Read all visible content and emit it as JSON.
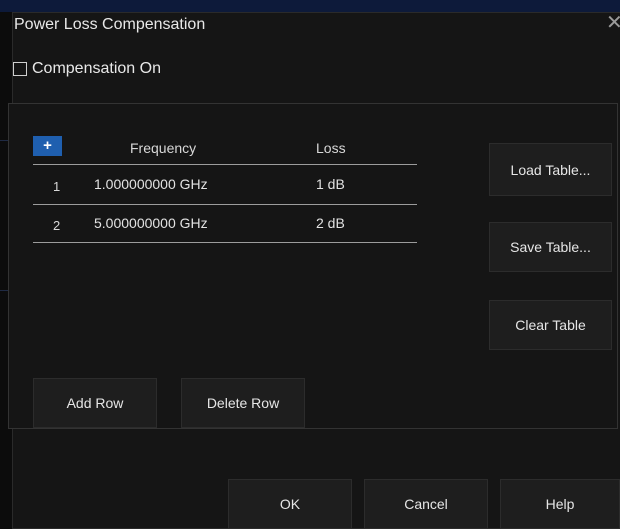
{
  "dialog": {
    "title": "Power Loss Compensation",
    "close_glyph": "✕"
  },
  "compensation": {
    "label": "Compensation On",
    "checked": false
  },
  "table": {
    "add_glyph": "+",
    "headers": {
      "frequency": "Frequency",
      "loss": "Loss"
    },
    "rows": [
      {
        "index": "1",
        "frequency": "1.000000000 GHz",
        "loss": "1 dB"
      },
      {
        "index": "2",
        "frequency": "5.000000000 GHz",
        "loss": "2 dB"
      }
    ]
  },
  "side_buttons": {
    "load": "Load Table...",
    "save": "Save Table...",
    "clear": "Clear Table"
  },
  "row_buttons": {
    "add": "Add Row",
    "delete": "Delete Row"
  },
  "footer_buttons": {
    "ok": "OK",
    "cancel": "Cancel",
    "help": "Help"
  },
  "colors": {
    "accent": "#1f5faf",
    "background": "#151515"
  }
}
